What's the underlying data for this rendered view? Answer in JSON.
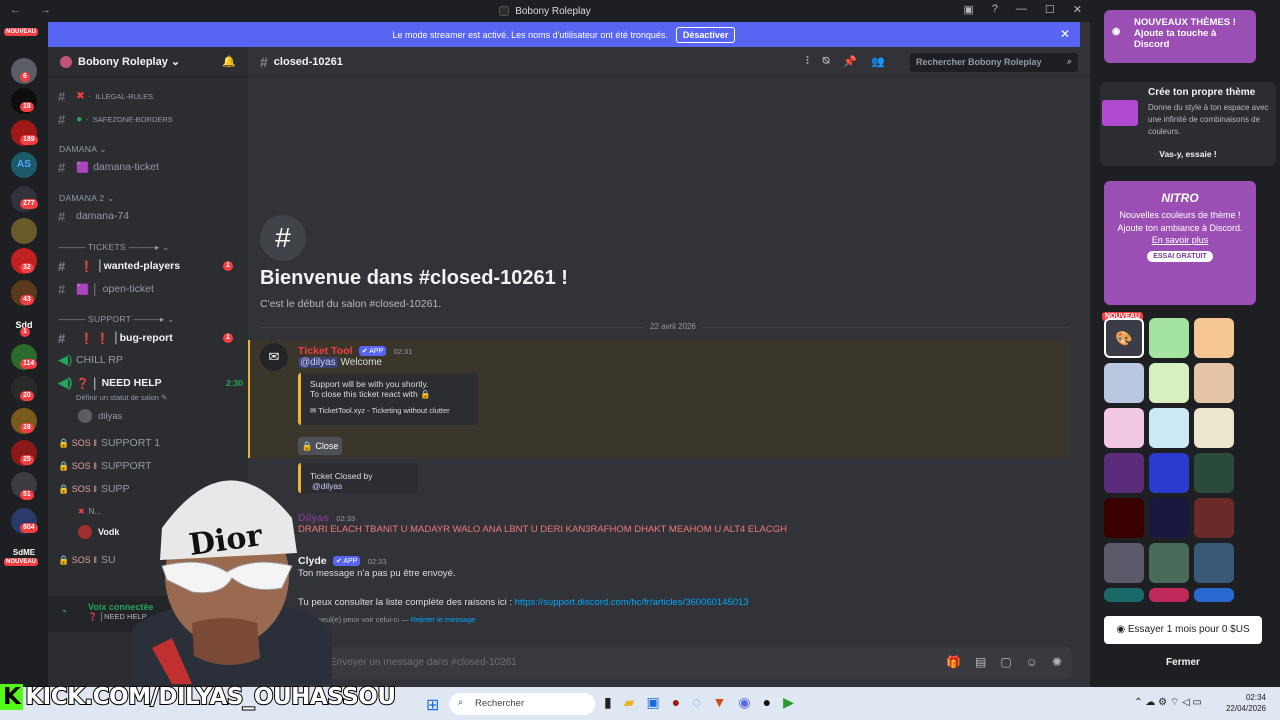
{
  "window": {
    "title": "Bobony Roleplay",
    "nav": "← →"
  },
  "banner": {
    "text": "Le mode streamer est activé. Les noms d'utilisateur ont été tronqués.",
    "button": "Désactiver"
  },
  "guilds": {
    "new_top": "NOUVEAU",
    "new_bottom": "NOUVEAU",
    "badges": [
      "6",
      "18",
      "189",
      "277",
      "32",
      "43",
      "1",
      "114",
      "20",
      "28",
      "25",
      "51",
      "804"
    ],
    "labels": [
      "AS",
      "Sdd",
      "SdME"
    ]
  },
  "server": {
    "name": "Bobony Roleplay",
    "name_chevron": "⌄",
    "bell_icon": "🔔"
  },
  "channels": [
    {
      "name": "ILLEGAL-RULES",
      "prefix": "✖ ·"
    },
    {
      "name": "SAFEZONE-BORDERS",
      "prefix": "● ·"
    },
    {
      "name": "damana-ticket",
      "prefix": "🟪"
    },
    {
      "name": "damana-74",
      "prefix": ""
    },
    {
      "name": "│wanted-players",
      "prefix": "❗",
      "badge": "1"
    },
    {
      "name": "open-ticket",
      "prefix": "🟪 │"
    },
    {
      "name": "│bug-report",
      "prefix": "❗ ❗",
      "badge": "1"
    },
    {
      "name": "CHILL RP",
      "prefix": ""
    },
    {
      "name": "NEED HELP",
      "prefix": "❓ │",
      "time": "2:30",
      "status": "Définir un statut de salon ✎"
    },
    {
      "name": "dilyas",
      "prefix": ""
    },
    {
      "name": "SUPPORT 1",
      "prefix": "🔒 SOS ‖"
    },
    {
      "name": "SUPPORT",
      "prefix": "🔒 SOS ‖"
    },
    {
      "name": "SUPP",
      "prefix": "🔒 SOS ‖"
    },
    {
      "name": "N...",
      "prefix": "✖"
    },
    {
      "name": "Vodk",
      "prefix": ""
    },
    {
      "name": "SU",
      "prefix": "🔒 SOS ‖"
    }
  ],
  "categories": [
    "DAMANA ⌄",
    "DAMANA 2 ⌄",
    "——— TICKETS ———▸ ⌄",
    "——— SUPPORT ———▸ ⌄"
  ],
  "voice": {
    "status": "Voix connectée",
    "channel": "❓ │NEED HELP"
  },
  "header": {
    "channel": "closed-10261",
    "search_placeholder": "Rechercher Bobony Roleplay"
  },
  "welcome": {
    "title": "Bienvenue dans #closed-10261 !",
    "subtitle": "C'est le début du salon #closed-10261.",
    "date": "22 avril 2026"
  },
  "messages": {
    "ticket": {
      "author": "Ticket Tool",
      "app": "✔ APP",
      "time": "02:31",
      "mention": "@dilyas",
      "text": "Welcome",
      "embed_line1": "Support will be with you shortly.",
      "embed_line2": "To close this ticket react with 🔒",
      "footer": "TicketTool.xyz - Ticketing without clutter",
      "close": "🔒 Close"
    },
    "closed": {
      "text": "Ticket Closed by",
      "mention": "@dilyas"
    },
    "dilyas": {
      "author": "Dilyas",
      "time": "02:33",
      "text": "DRARI ELACH TBANIT U MADAYR WALO ANA LBNT U DERI KAN3RAFHOM DHAKT MEAHOM U ALT4 ELACGH"
    },
    "clyde": {
      "author": "Clyde",
      "app": "✔ APP",
      "time": "02:33",
      "text1": "Ton message n'a pas pu être envoyé.",
      "text2": "Tu peux consulter la liste complète des raisons ici :",
      "link": "https://support.discord.com/hc/fr/articles/360060145013",
      "ephemeral": "Toi seul(e) peux voir celui-ci — ",
      "dismiss": "Rejeter le message"
    }
  },
  "composer": {
    "placeholder": "Envoyer un message dans #closed-10261"
  },
  "sidepanel": {
    "promo1": "NOUVEAUX THÈMES ! Ajoute ta touche à Discord",
    "create_title": "Crée ton propre thème",
    "create_desc": "Donne du style à ton espace avec une infinité de combinaisons de couleurs.",
    "try": "Vas-y, essaie !",
    "nitro_logo": "NITRO",
    "nitro_text": "Nouvelles couleurs de thème ! Ajoute ton ambiance à Discord.",
    "nitro_link": "En savoir plus",
    "free_trial": "ESSAI GRATUIT",
    "new_tag": "NOUVEAU",
    "trial_btn": "Essayer 1 mois pour 0 $US",
    "close": "Fermer",
    "swatches": [
      "#3a3c48",
      "#a5e4a0",
      "#f6c694",
      "#b9c8e0",
      "#d8f0c0",
      "#e6c4a8",
      "#f2c8e2",
      "#cce8f6",
      "#ece6cc",
      "#5a2c7a",
      "#2a3ccf",
      "#2a4a3a",
      "#3a0000",
      "#1a1840",
      "#6a2a2a",
      "#5a5a6a",
      "#4a6a5a",
      "#3a5a7a",
      "#1a6a6a",
      "#c02a5a",
      "#2a6ad0"
    ]
  },
  "stream": {
    "overlay": "KICK.COM/DILYAS_OUHASSOU",
    "k": "K"
  },
  "taskbar": {
    "search": "Rechercher",
    "time": "02:34",
    "date": "22/04/2026"
  },
  "colors": {
    "accent": "#5865f2",
    "highlight": "#f0b232",
    "danger": "#f23f43",
    "kick": "#53fc18"
  }
}
